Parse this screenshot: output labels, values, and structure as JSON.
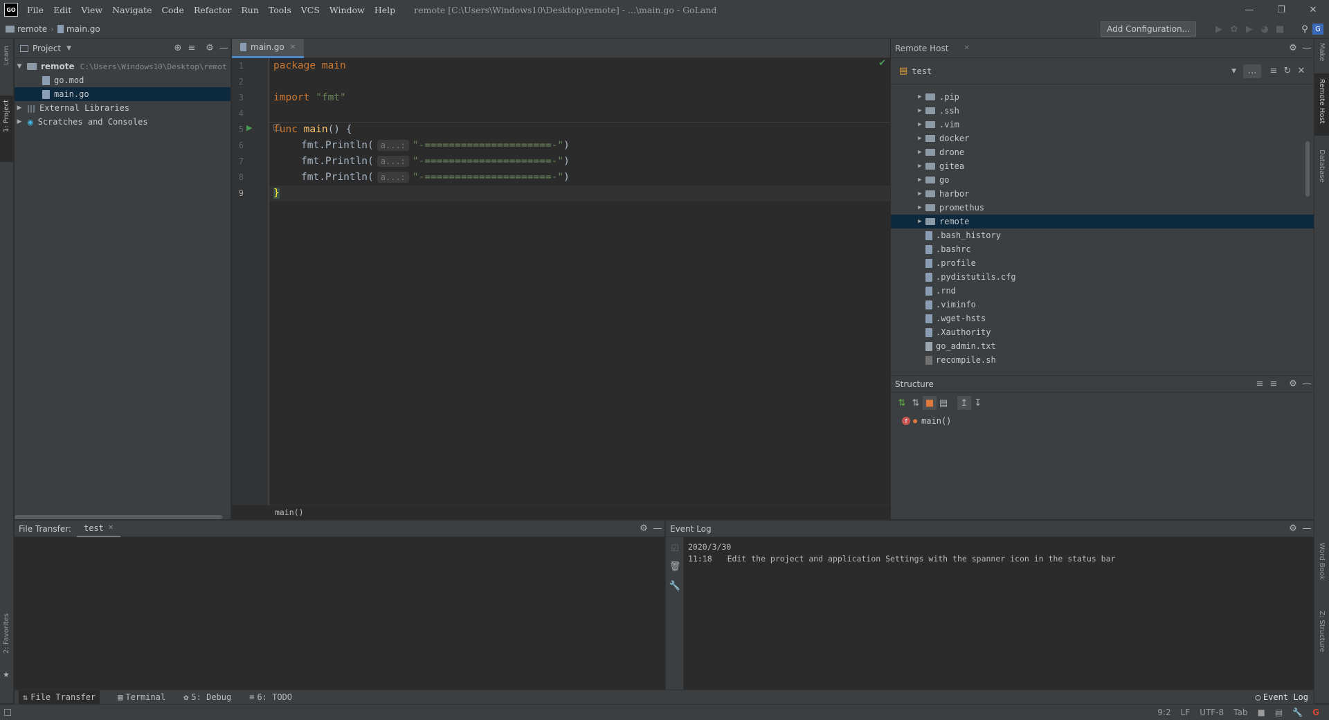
{
  "app": {
    "logo": "GO",
    "window_title": "remote [C:\\Users\\Windows10\\Desktop\\remote] - ...\\main.go - GoLand",
    "menu": [
      "File",
      "Edit",
      "View",
      "Navigate",
      "Code",
      "Refactor",
      "Run",
      "Tools",
      "VCS",
      "Window",
      "Help"
    ]
  },
  "navbar": {
    "breadcrumbs": [
      "remote",
      "main.go"
    ],
    "add_configuration": "Add Configuration..."
  },
  "left_stripe": {
    "learn": "Learn",
    "project": "1: Project",
    "favorites": "2: Favorites"
  },
  "right_stripe": {
    "make": "Make",
    "remote_host": "Remote Host",
    "database": "Database",
    "word_book": "Word Book",
    "structure": "Z: Structure"
  },
  "project": {
    "header": "Project",
    "tree": [
      {
        "label": "remote",
        "path": "C:\\Users\\Windows10\\Desktop\\remot",
        "type": "folder",
        "expanded": true,
        "depth": 0
      },
      {
        "label": "go.mod",
        "type": "file",
        "depth": 1
      },
      {
        "label": "main.go",
        "type": "file",
        "depth": 1,
        "selected": true
      },
      {
        "label": "External Libraries",
        "type": "lib",
        "depth": 0
      },
      {
        "label": "Scratches and Consoles",
        "type": "scratch",
        "depth": 0
      }
    ]
  },
  "editor": {
    "tab": "main.go",
    "line_numbers": [
      "1",
      "2",
      "3",
      "4",
      "5",
      "6",
      "7",
      "8",
      "9"
    ],
    "code": {
      "l1_kw": "package",
      "l1_rest": " main",
      "l3_kw": "import",
      "l3_str": " \"fmt\"",
      "l5_kw": "func",
      "l5_fn": " main",
      "l5_rest": "() {",
      "println": "fmt.Println(",
      "hint": "a...:",
      "line_str": "\"-=====================-\"",
      "close": ")",
      "l9": "}"
    },
    "breadcrumb_footer": "main()"
  },
  "remote_host": {
    "title": "Remote Host",
    "server": "test",
    "items": [
      {
        "label": ".pip",
        "type": "folder"
      },
      {
        "label": ".ssh",
        "type": "folder"
      },
      {
        "label": ".vim",
        "type": "folder"
      },
      {
        "label": "docker",
        "type": "folder"
      },
      {
        "label": "drone",
        "type": "folder"
      },
      {
        "label": "gitea",
        "type": "folder"
      },
      {
        "label": "go",
        "type": "folder"
      },
      {
        "label": "harbor",
        "type": "folder"
      },
      {
        "label": "promethus",
        "type": "folder"
      },
      {
        "label": "remote",
        "type": "folder",
        "selected": true
      },
      {
        "label": ".bash_history",
        "type": "file"
      },
      {
        "label": ".bashrc",
        "type": "file"
      },
      {
        "label": ".profile",
        "type": "file"
      },
      {
        "label": ".pydistutils.cfg",
        "type": "file"
      },
      {
        "label": ".rnd",
        "type": "file"
      },
      {
        "label": ".viminfo",
        "type": "file"
      },
      {
        "label": ".wget-hsts",
        "type": "file"
      },
      {
        "label": ".Xauthority",
        "type": "file"
      },
      {
        "label": "go_admin.txt",
        "type": "file"
      },
      {
        "label": "recompile.sh",
        "type": "file"
      }
    ]
  },
  "structure": {
    "title": "Structure",
    "item": "main()"
  },
  "file_transfer": {
    "title": "File Transfer:",
    "tab": "test"
  },
  "event_log": {
    "title": "Event Log",
    "date": "2020/3/30",
    "time": "11:18",
    "message": "Edit the project and application Settings with the spanner icon in the status bar"
  },
  "tool_windows": [
    "File Transfer",
    "Terminal",
    "5: Debug",
    "6: TODO"
  ],
  "tool_event_log": "Event Log",
  "status": {
    "position": "9:2",
    "line_sep": "LF",
    "encoding": "UTF-8",
    "indent": "Tab"
  }
}
